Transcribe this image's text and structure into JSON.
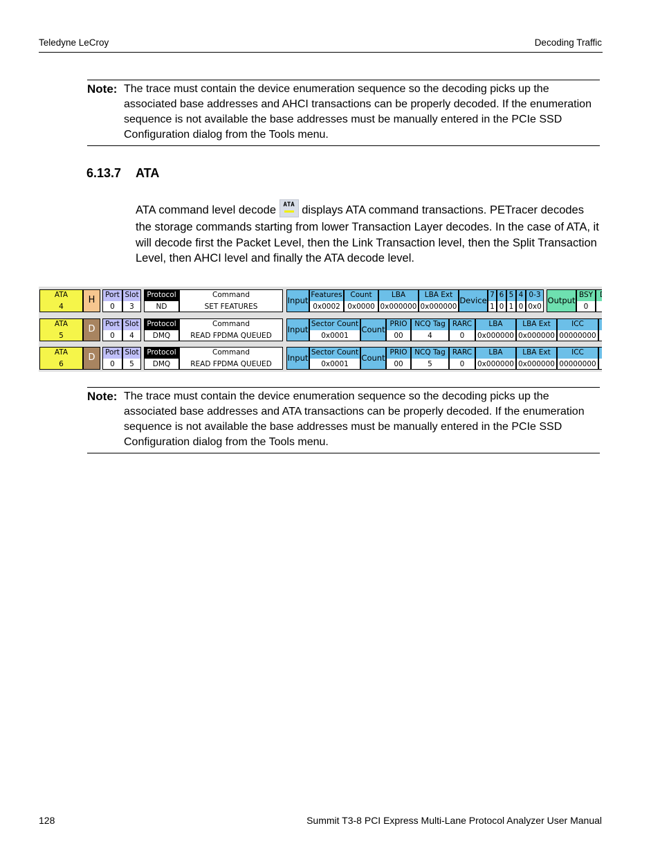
{
  "header": {
    "left": "Teledyne LeCroy",
    "right": "Decoding Traffic"
  },
  "note1": {
    "label": "Note:",
    "text": "The trace must contain the device enumeration sequence so the decoding picks up the associated base addresses and AHCI transactions can be properly decoded. If the enumeration sequence is not available the base addresses must be manually entered in the PCIe SSD Configuration dialog from the Tools menu."
  },
  "section": {
    "number": "6.13.7",
    "title": "ATA"
  },
  "paragraph": {
    "before_icon": "ATA command level decode",
    "icon_label": "ATA",
    "after_icon": " displays ATA  command transactions. PETracer decodes the storage commands starting from lower Transaction Layer decodes. In the case of ATA, it will decode first the Packet Level, then the Link Transaction level, then the Split Transaction Level, then AHCI level and finally the ATA decode level."
  },
  "trace": {
    "colors": {
      "packet": "#f5f54a",
      "host": "#f6c68f",
      "device": "#a88460",
      "port_slot": "#c0c0f8",
      "protocol": "#000000",
      "input": "#6cbfe8",
      "output": "#6ee0b0"
    },
    "rows": [
      {
        "type": "A",
        "fields": [
          {
            "label": "ATA",
            "value": "4"
          },
          {
            "label": "H"
          },
          {
            "label": "Port",
            "value": "0"
          },
          {
            "label": "Slot",
            "value": "3"
          },
          {
            "label": "Protocol",
            "value": "ND"
          },
          {
            "label": "Command",
            "value": "SET FEATURES"
          },
          {
            "label": "Input"
          },
          {
            "label": "Features",
            "value": "0x0002"
          },
          {
            "label": "Count",
            "value": "0x0000"
          },
          {
            "label": "LBA",
            "value": "0x000000"
          },
          {
            "label": "LBA Ext",
            "value": "0x000000"
          },
          {
            "label": "Device"
          },
          {
            "label": "7",
            "value": "1"
          },
          {
            "label": "6",
            "value": "0"
          },
          {
            "label": "5",
            "value": "1"
          },
          {
            "label": "4",
            "value": "0"
          },
          {
            "label": "0-3",
            "value": "0x0"
          },
          {
            "label": "Output"
          },
          {
            "label": "BSY",
            "value": "0"
          },
          {
            "label": "D",
            "value": ""
          }
        ]
      },
      {
        "type": "B",
        "fields": [
          {
            "label": "ATA",
            "value": "5"
          },
          {
            "label": "D"
          },
          {
            "label": "Port",
            "value": "0"
          },
          {
            "label": "Slot",
            "value": "4"
          },
          {
            "label": "Protocol",
            "value": "DMQ"
          },
          {
            "label": "Command",
            "value": "READ FPDMA QUEUED"
          },
          {
            "label": "Input"
          },
          {
            "label": "Sector Count",
            "value": "0x0001"
          },
          {
            "label": "Count"
          },
          {
            "label": "PRIO",
            "value": "00"
          },
          {
            "label": "NCQ Tag",
            "value": "4"
          },
          {
            "label": "RARC",
            "value": "0"
          },
          {
            "label": "LBA",
            "value": "0x000000"
          },
          {
            "label": "LBA Ext",
            "value": "0x000000"
          },
          {
            "label": "ICC",
            "value": "00000000"
          },
          {
            "label": "I",
            "value": ""
          }
        ]
      },
      {
        "type": "B",
        "fields": [
          {
            "label": "ATA",
            "value": "6"
          },
          {
            "label": "D"
          },
          {
            "label": "Port",
            "value": "0"
          },
          {
            "label": "Slot",
            "value": "5"
          },
          {
            "label": "Protocol",
            "value": "DMQ"
          },
          {
            "label": "Command",
            "value": "READ FPDMA QUEUED"
          },
          {
            "label": "Input"
          },
          {
            "label": "Sector Count",
            "value": "0x0001"
          },
          {
            "label": "Count"
          },
          {
            "label": "PRIO",
            "value": "00"
          },
          {
            "label": "NCQ Tag",
            "value": "5"
          },
          {
            "label": "RARC",
            "value": "0"
          },
          {
            "label": "LBA",
            "value": "0x000000"
          },
          {
            "label": "LBA Ext",
            "value": "0x000000"
          },
          {
            "label": "ICC",
            "value": "00000000"
          },
          {
            "label": "I",
            "value": ""
          }
        ]
      }
    ]
  },
  "note2": {
    "label": "Note:",
    "text": "The trace must contain the device enumeration sequence so the decoding picks up the associated base addresses and ATA transactions can be properly decoded. If the enumeration sequence is not available the base addresses must be manually entered in the PCIe SSD Configuration dialog from the Tools menu."
  },
  "footer": {
    "page": "128",
    "title": "Summit T3-8 PCI Express Multi-Lane Protocol Analyzer User Manual"
  }
}
